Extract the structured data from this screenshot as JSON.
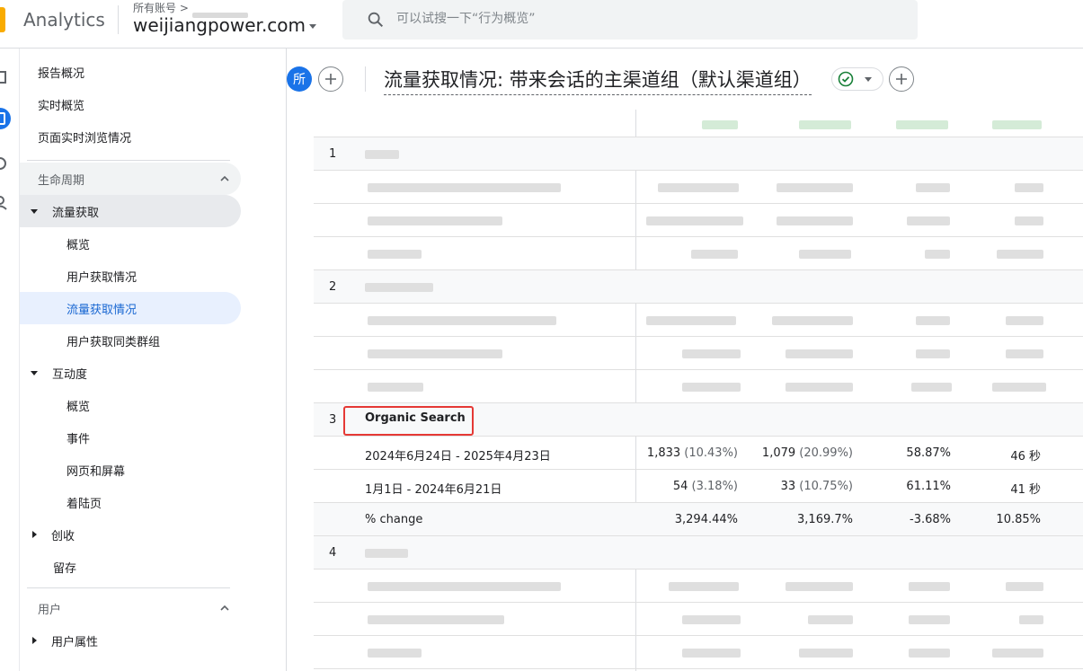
{
  "topbar": {
    "app_name": "Analytics",
    "account_breadcrumb": "所有账号 >",
    "property_name": "weijiangpower.com",
    "search_placeholder": "可以试搜一下“行为概览”"
  },
  "sidebar": {
    "items": [
      {
        "label": "报告概况"
      },
      {
        "label": "实时概览"
      },
      {
        "label": "页面实时浏览情况"
      }
    ],
    "lifecycle_label": "生命周期",
    "acquisition": {
      "label": "流量获取",
      "children": [
        "概览",
        "用户获取情况",
        "流量获取情况",
        "用户获取同类群组"
      ]
    },
    "engagement": {
      "label": "互动度",
      "children": [
        "概览",
        "事件",
        "网页和屏幕",
        "着陆页"
      ]
    },
    "monetization_label": "创收",
    "retention_label": "留存",
    "user_section_label": "用户",
    "user_attributes_label": "用户属性"
  },
  "report": {
    "compare_chip": "所",
    "title": "流量获取情况: 带来会话的主渠道组（默认渠道组）"
  },
  "table": {
    "group_indexes": [
      "1",
      "2",
      "3",
      "4"
    ],
    "organic_search": {
      "name": "Organic Search",
      "rows": [
        {
          "label": "2024年6月24日 - 2025年4月23日",
          "c1": "1,833",
          "c1p": "(10.43%)",
          "c2": "1,079",
          "c2p": "(20.99%)",
          "c3": "58.87%",
          "c4": "46 秒"
        },
        {
          "label": "1月1日 - 2024年6月21日",
          "c1": "54",
          "c1p": "(3.18%)",
          "c2": "33",
          "c2p": "(10.75%)",
          "c3": "61.11%",
          "c4": "41 秒"
        },
        {
          "label": "% change",
          "c1": "3,294.44%",
          "c1p": "",
          "c2": "3,169.7%",
          "c2p": "",
          "c3": "-3.68%",
          "c4": "10.85%"
        }
      ]
    }
  },
  "colors": {
    "accent": "#1a73e8",
    "highlight_box": "#e53935",
    "logo": "#f9ab00",
    "check": "#188038"
  }
}
